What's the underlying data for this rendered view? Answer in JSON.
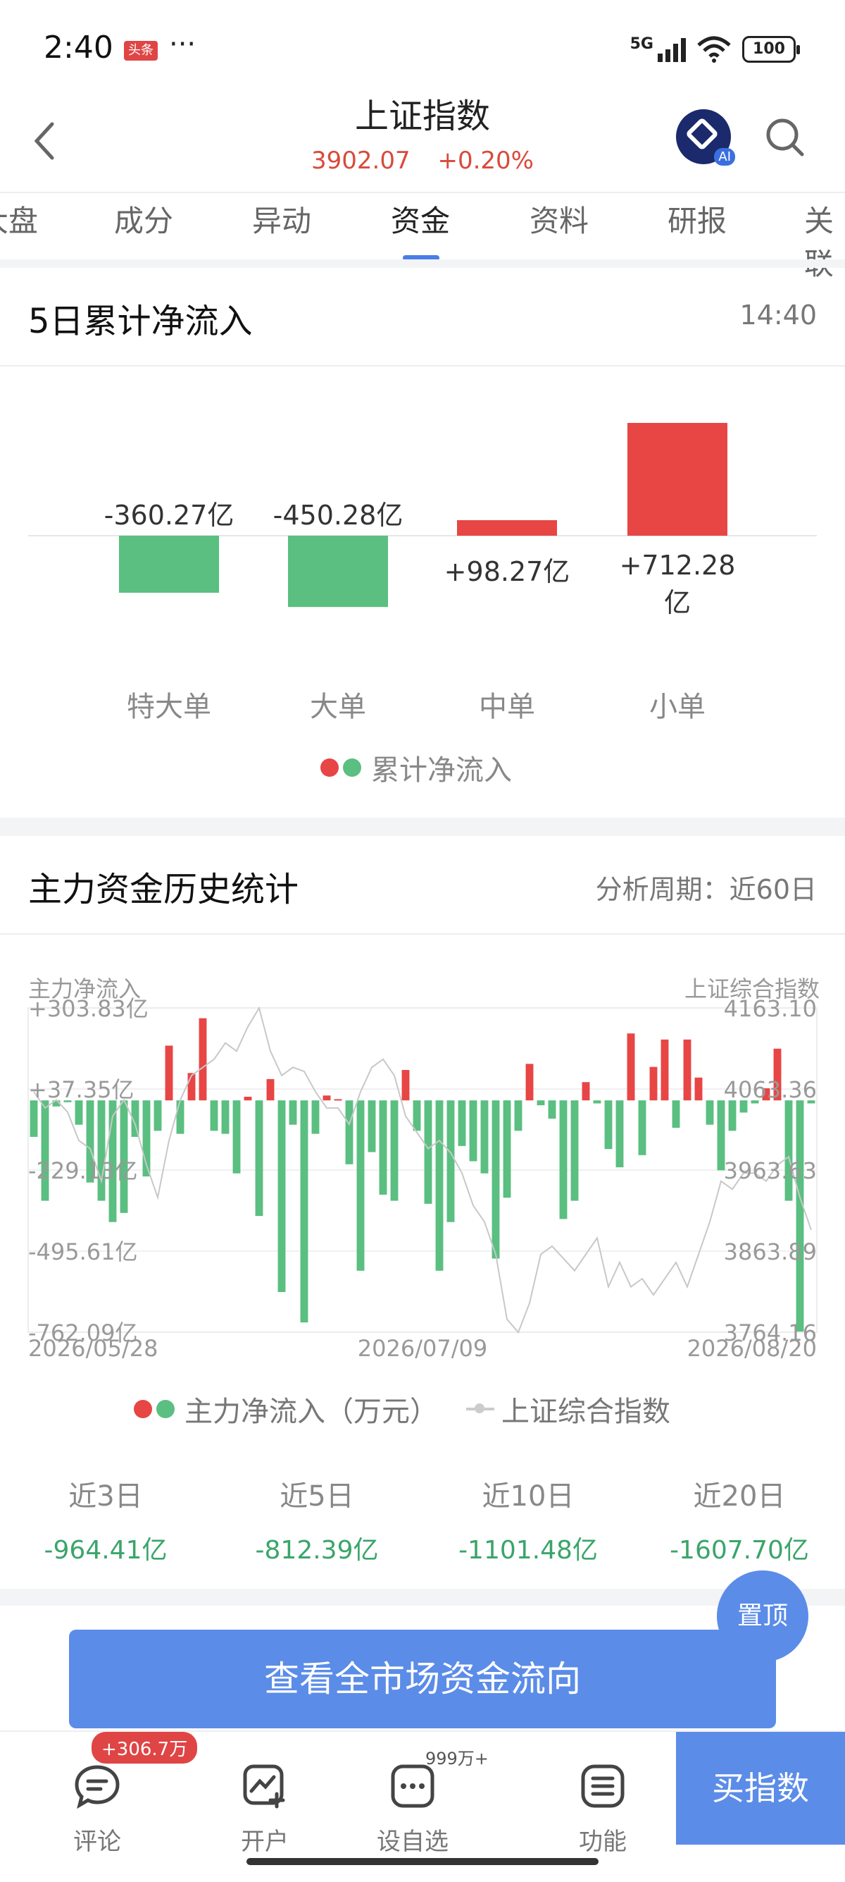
{
  "status_bar": {
    "time": "2:40",
    "app_badge": "头条",
    "more": "···",
    "network": "5G",
    "battery": "100"
  },
  "header": {
    "title": "上证指数",
    "price": "3902.07",
    "change": "+0.20%",
    "ai_tag": "AI"
  },
  "tabs": [
    {
      "label": "大盘"
    },
    {
      "label": "成分"
    },
    {
      "label": "异动"
    },
    {
      "label": "资金",
      "active": true
    },
    {
      "label": "资料"
    },
    {
      "label": "研报"
    },
    {
      "label": "关联"
    }
  ],
  "section1": {
    "title": "5日累计净流入",
    "time": "14:40"
  },
  "chart_data": [
    {
      "type": "bar",
      "categories": [
        "特大单",
        "大单",
        "中单",
        "小单"
      ],
      "values": [
        -360.27,
        -450.28,
        98.27,
        712.28
      ],
      "data_labels": [
        "-360.27亿",
        "-450.28亿",
        "+98.27亿",
        "+712.28亿"
      ],
      "legend": "累计净流入",
      "colors": {
        "positive": "#e84545",
        "negative": "#5abf80"
      }
    },
    {
      "type": "bar",
      "title": "主力资金历史统计",
      "period_label": "分析周期：近60日",
      "y_left_label": "主力净流入",
      "y_right_label": "上证综合指数",
      "y_left_ticks": [
        "+303.83亿",
        "+37.35亿",
        "-229.13亿",
        "-495.61亿",
        "-762.09亿"
      ],
      "y_right_ticks": [
        "4163.10",
        "4063.36",
        "3963.63",
        "3863.89",
        "3764.16"
      ],
      "x_ticks": [
        "2026/05/28",
        "2026/07/09",
        "2026/08/20"
      ],
      "ylim_left": [
        -762.09,
        303.83
      ],
      "ylim_right": [
        3764.16,
        4163.1
      ],
      "series": [
        {
          "name": "主力净流入（万元）",
          "values": [
            -120,
            -330,
            -20,
            -6,
            -80,
            -270,
            -330,
            -400,
            -370,
            -120,
            -250,
            -100,
            180,
            -110,
            90,
            270,
            -100,
            -110,
            -240,
            12,
            -380,
            70,
            -630,
            -80,
            -730,
            -110,
            16,
            4,
            -210,
            -560,
            -170,
            -310,
            -330,
            100,
            -100,
            -340,
            -560,
            -400,
            -150,
            -200,
            -240,
            -520,
            -320,
            -100,
            120,
            -16,
            -60,
            -390,
            -330,
            60,
            -10,
            -160,
            -220,
            220,
            -180,
            110,
            200,
            -90,
            200,
            75,
            -80,
            -230,
            -100,
            -40,
            -10,
            40,
            170,
            -330,
            -760,
            -10
          ]
        },
        {
          "name": "上证综合指数",
          "values": [
            4060,
            4040,
            4050,
            4035,
            4000,
            3990,
            3950,
            4030,
            4050,
            4020,
            3970,
            3930,
            4000,
            4050,
            4080,
            4090,
            4100,
            4120,
            4110,
            4140,
            4163,
            4110,
            4080,
            4090,
            4085,
            4060,
            4040,
            4040,
            4020,
            4060,
            4090,
            4100,
            4080,
            4030,
            4010,
            3990,
            4000,
            3985,
            3960,
            3920,
            3900,
            3860,
            3780,
            3764,
            3800,
            3860,
            3870,
            3855,
            3840,
            3860,
            3880,
            3820,
            3850,
            3820,
            3830,
            3810,
            3830,
            3850,
            3820,
            3860,
            3900,
            3950,
            3940,
            3960,
            3960,
            3950,
            3970,
            3980,
            3930,
            3890
          ]
        }
      ]
    }
  ],
  "section2": {
    "title": "主力资金历史统计",
    "period": "分析周期：近60日"
  },
  "stats": [
    {
      "label": "近3日",
      "value": "-964.41亿"
    },
    {
      "label": "近5日",
      "value": "-812.39亿"
    },
    {
      "label": "近10日",
      "value": "-1101.48亿"
    },
    {
      "label": "近20日",
      "value": "-1607.70亿"
    }
  ],
  "top_button": "置顶",
  "cta": "查看全市场资金流向",
  "bottom_nav": {
    "items": [
      {
        "label": "评论",
        "badge": "+306.7万",
        "icon": "comment-icon"
      },
      {
        "label": "开户",
        "icon": "open-account-icon"
      },
      {
        "label": "设自选",
        "badge": "999万+",
        "icon": "watchlist-icon"
      },
      {
        "label": "功能",
        "icon": "menu-icon"
      }
    ],
    "buy": "买指数"
  }
}
